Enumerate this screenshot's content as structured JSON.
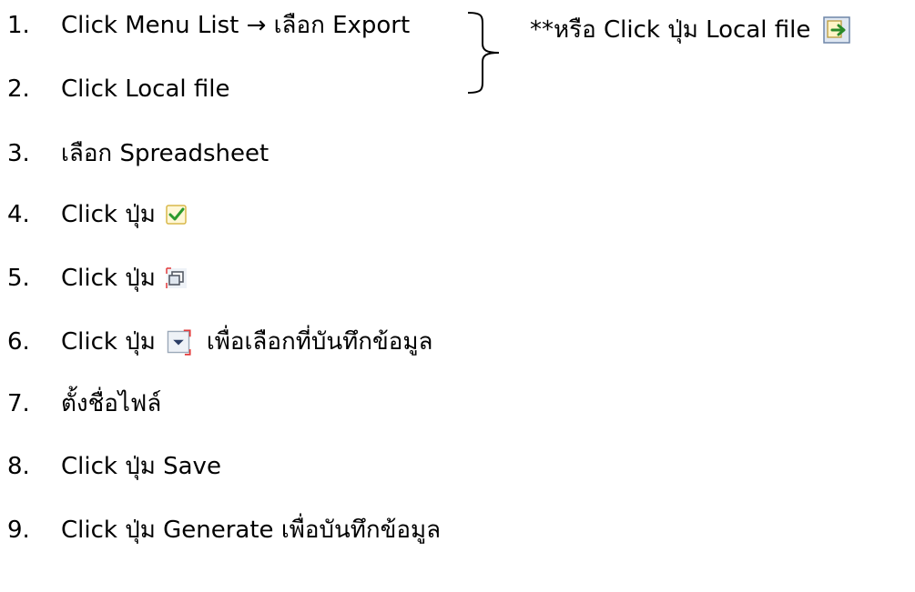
{
  "steps": [
    {
      "number": "1.",
      "text": "Click Menu List → เลือก Export"
    },
    {
      "number": "2.",
      "text": "Click Local file"
    },
    {
      "number": "3.",
      "text": "เลือก Spreadsheet"
    },
    {
      "number": "4.",
      "text": "Click ปุ่ม",
      "icon": "checkmark-icon"
    },
    {
      "number": "5.",
      "text": "Click ปุ่ม",
      "icon": "window-restore-icon"
    },
    {
      "number": "6.",
      "text": "Click ปุ่ม",
      "icon": "dropdown-arrow-icon",
      "suffix": "เพื่อเลือกที่บันทึกข้อมูล"
    },
    {
      "number": "7.",
      "text": "ตั้งชื่อไฟล์"
    },
    {
      "number": "8.",
      "text": "Click ปุ่ม Save"
    },
    {
      "number": "9.",
      "text": "Click ปุ่ม Generate เพื่อบันทึกข้อมูล"
    }
  ],
  "note": {
    "text": "**หรือ Click ปุ่ม Local file",
    "icon": "local-file-export-icon"
  }
}
